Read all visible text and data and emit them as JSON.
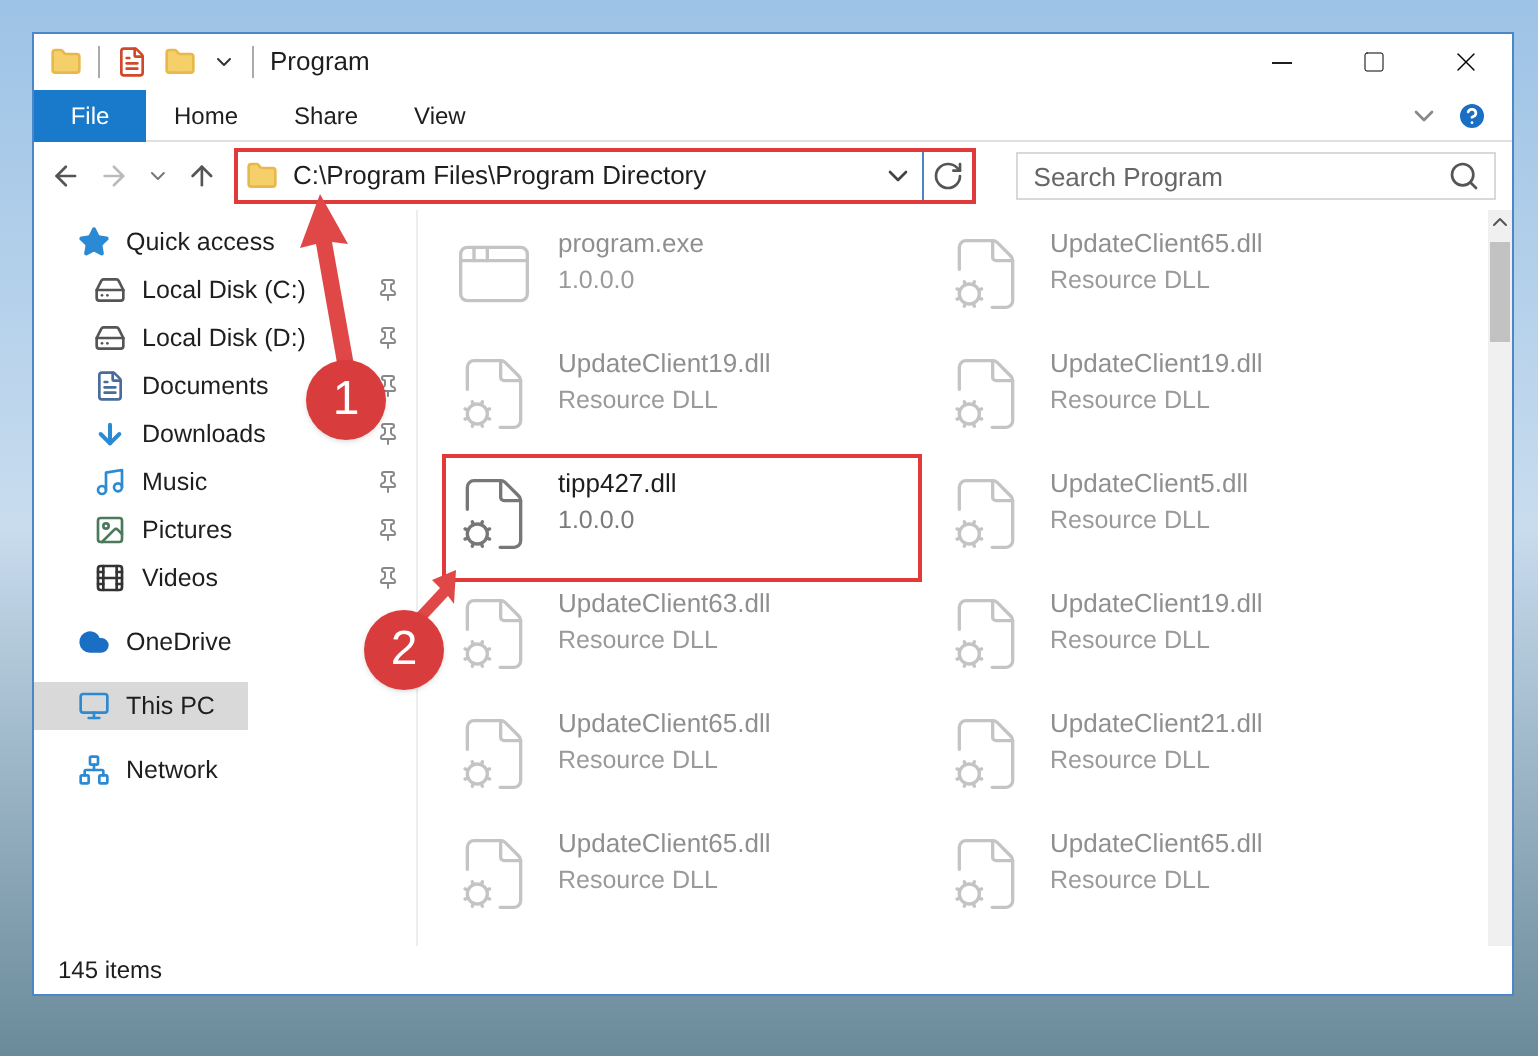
{
  "window": {
    "title": "Program"
  },
  "ribbon_tabs": [
    {
      "label": "File",
      "selected": true
    },
    {
      "label": "Home",
      "selected": false
    },
    {
      "label": "Share",
      "selected": false
    },
    {
      "label": "View",
      "selected": false
    }
  ],
  "address_bar": {
    "path": "C:\\Program Files\\Program Directory",
    "highlighted": true
  },
  "search": {
    "placeholder": "Search Program"
  },
  "sidebar": {
    "items": [
      {
        "label": "Quick access",
        "selected": false,
        "children": [
          {
            "label": "Local Disk (C:)",
            "pinned": true,
            "selected": false
          },
          {
            "label": "Local Disk (D:)",
            "pinned": true,
            "selected": false
          },
          {
            "label": "Documents",
            "pinned": true,
            "selected": false
          },
          {
            "label": "Downloads",
            "pinned": true,
            "selected": false
          },
          {
            "label": "Music",
            "pinned": true,
            "selected": false
          },
          {
            "label": "Pictures",
            "pinned": true,
            "selected": false
          },
          {
            "label": "Videos",
            "pinned": true,
            "selected": false
          }
        ]
      },
      {
        "label": "OneDrive",
        "selected": false
      },
      {
        "label": "This PC",
        "selected": true
      },
      {
        "label": "Network",
        "selected": false
      }
    ]
  },
  "files": [
    {
      "name": "program.exe",
      "detail": "1.0.0.0",
      "kind": "exe",
      "blurred": true,
      "highlighted": false
    },
    {
      "name": "UpdateClient65.dll",
      "detail": "Resource DLL",
      "kind": "dll",
      "blurred": true,
      "highlighted": false
    },
    {
      "name": "UpdateClient19.dll",
      "detail": "Resource DLL",
      "kind": "dll",
      "blurred": true,
      "highlighted": false
    },
    {
      "name": "UpdateClient19.dll",
      "detail": "Resource DLL",
      "kind": "dll",
      "blurred": true,
      "highlighted": false
    },
    {
      "name": "tipp427.dll",
      "detail": "1.0.0.0",
      "kind": "dll",
      "blurred": false,
      "highlighted": true
    },
    {
      "name": "UpdateClient5.dll",
      "detail": "Resource DLL",
      "kind": "dll",
      "blurred": true,
      "highlighted": false
    },
    {
      "name": "UpdateClient63.dll",
      "detail": "Resource DLL",
      "kind": "dll",
      "blurred": true,
      "highlighted": false
    },
    {
      "name": "UpdateClient19.dll",
      "detail": "Resource DLL",
      "kind": "dll",
      "blurred": true,
      "highlighted": false
    },
    {
      "name": "UpdateClient65.dll",
      "detail": "Resource DLL",
      "kind": "dll",
      "blurred": true,
      "highlighted": false
    },
    {
      "name": "UpdateClient21.dll",
      "detail": "Resource DLL",
      "kind": "dll",
      "blurred": true,
      "highlighted": false
    },
    {
      "name": "UpdateClient65.dll",
      "detail": "Resource DLL",
      "kind": "dll",
      "blurred": true,
      "highlighted": false
    },
    {
      "name": "UpdateClient65.dll",
      "detail": "Resource DLL",
      "kind": "dll",
      "blurred": true,
      "highlighted": false
    }
  ],
  "annotations": [
    {
      "label": "1"
    },
    {
      "label": "2"
    }
  ],
  "status_bar": {
    "count": "145 items"
  }
}
